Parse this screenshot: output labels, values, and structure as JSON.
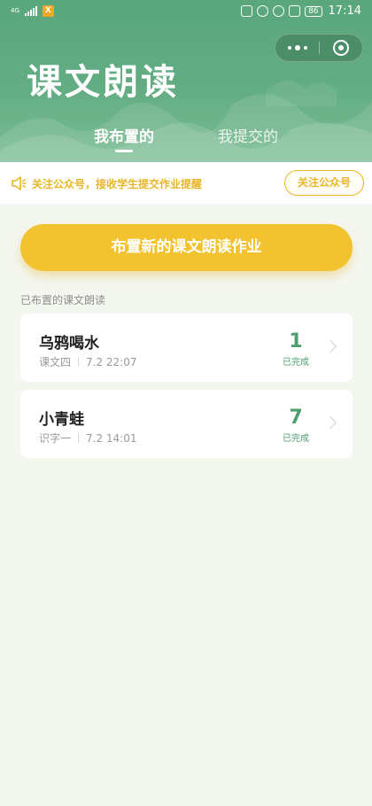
{
  "status_bar": {
    "network": "4G",
    "battery": "86",
    "time": "17:14",
    "app_badge": "X"
  },
  "header": {
    "title": "课文朗读",
    "capsule": {
      "menu_icon": "more-dots-icon",
      "close_icon": "target-icon"
    },
    "tabs": [
      {
        "label": "我布置的",
        "active": true
      },
      {
        "label": "我提交的",
        "active": false
      }
    ]
  },
  "notice": {
    "icon": "speaker-icon",
    "text": "关注公众号，接收学生提交作业提醒",
    "button_label": "关注公众号"
  },
  "main_button": {
    "label": "布置新的课文朗读作业"
  },
  "list": {
    "section_label": "已布置的课文朗读",
    "items": [
      {
        "title": "乌鸦喝水",
        "lesson": "课文四",
        "time": "7.2 22:07",
        "count": "1",
        "count_label": "已完成"
      },
      {
        "title": "小青蛙",
        "lesson": "识字一",
        "time": "7.2 14:01",
        "count": "7",
        "count_label": "已完成"
      }
    ]
  },
  "colors": {
    "header_green": "#5aa77d",
    "accent_yellow": "#f2c32e",
    "count_green": "#4e9d6f",
    "page_bg": "#f4f6f0"
  }
}
